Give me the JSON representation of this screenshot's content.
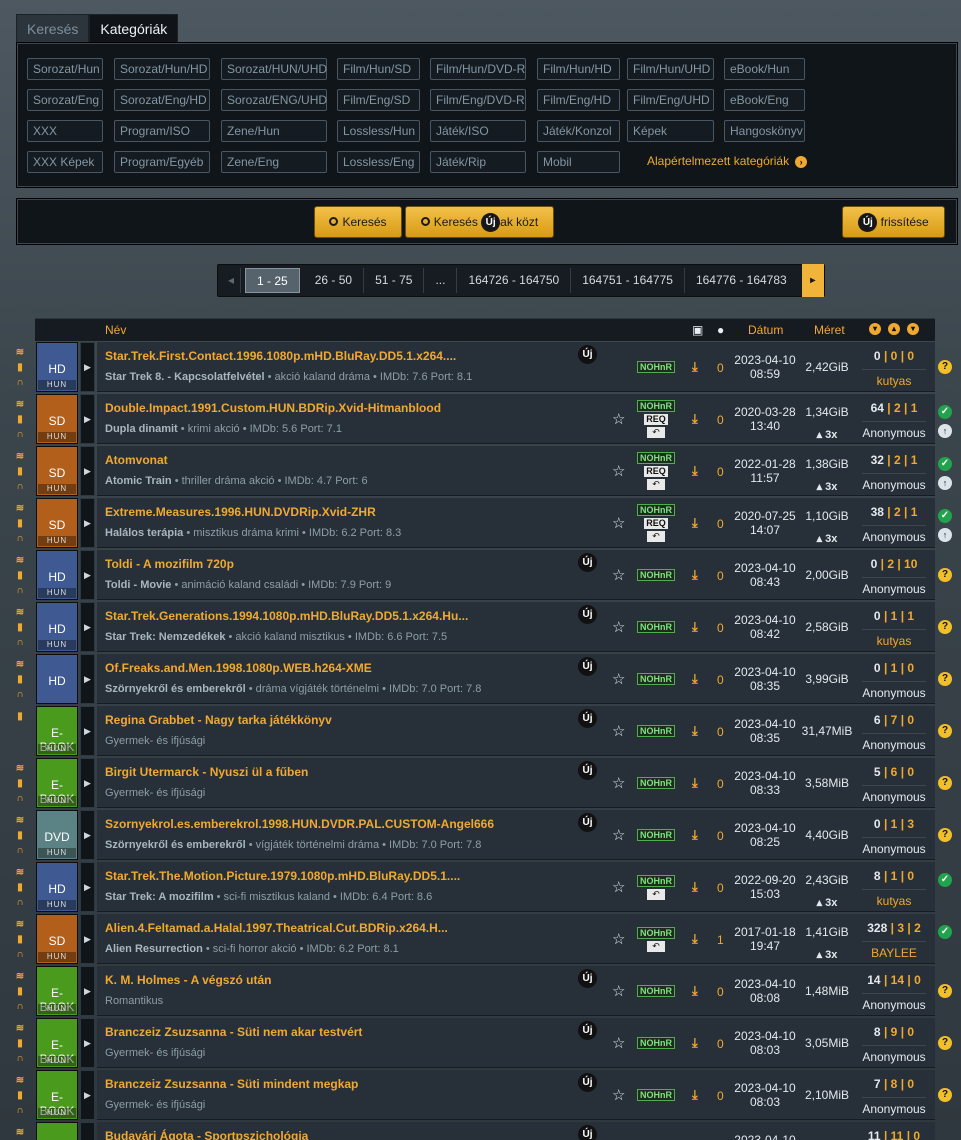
{
  "tabs": {
    "search": "Keresés",
    "categories": "Kategóriák"
  },
  "categories": {
    "rows": [
      [
        "Sorozat/Hun",
        "Sorozat/Hun/HD",
        "Sorozat/HUN/UHD",
        "Film/Hun/SD",
        "Film/Hun/DVD-R",
        "Film/Hun/HD",
        "Film/Hun/UHD",
        "eBook/Hun"
      ],
      [
        "Sorozat/Eng",
        "Sorozat/Eng/HD",
        "Sorozat/ENG/UHD",
        "Film/Eng/SD",
        "Film/Eng/DVD-R",
        "Film/Eng/HD",
        "Film/Eng/UHD",
        "eBook/Eng"
      ],
      [
        "XXX",
        "Program/ISO",
        "Zene/Hun",
        "Lossless/Hun",
        "Játék/ISO",
        "Játék/Konzol",
        "Képek",
        "Hangoskönyv"
      ],
      [
        "XXX Képek",
        "Program/Egyéb",
        "Zene/Eng",
        "Lossless/Eng",
        "Játék/Rip",
        "Mobil"
      ]
    ],
    "default_link": "Alapértelmezett kategóriák"
  },
  "search": {
    "search_button": "Keresés",
    "search_new_prefix": "Keresés",
    "search_new_suffix": "ak közt",
    "new_badge": "Új",
    "refresh_suffix": "frissítése"
  },
  "pagination": {
    "pages": [
      "1 - 25",
      "26 - 50",
      "51 - 75",
      "...",
      "164726 - 164750",
      "164751 - 164775",
      "164776 - 164783"
    ]
  },
  "table_header": {
    "name": "Név",
    "date": "Dátum",
    "size": "Méret"
  },
  "torrents": [
    {
      "cat": "HD",
      "catbg": "#3f5a92",
      "name": "Star.Trek.First.Contact.1996.1080p.mHD.BluRay.DD5.1.x264....",
      "title": "Star Trek 8. - Kapcsolatfelvétel",
      "meta": "• akció  kaland  dráma • IMDb: 7.6  Port: 8.1",
      "new": true,
      "star": false,
      "req": false,
      "undo": false,
      "comments": "0",
      "date": "2023-04-10",
      "time": "08:59",
      "size": "2,42GiB",
      "mult": "",
      "seed": "0",
      "leech": "0",
      "done": "0",
      "uploader": "kutyas",
      "gold": true,
      "status": "q",
      "rss": true
    },
    {
      "cat": "SD",
      "catbg": "#b15f1a",
      "name": "Double.Impact.1991.Custom.HUN.BDRip.Xvid-Hitmanblood",
      "title": "Dupla dinamit",
      "meta": "• krimi  akció • IMDb: 5.6  Port: 7.1",
      "new": false,
      "star": true,
      "req": true,
      "undo": true,
      "comments": "0",
      "date": "2020-03-28",
      "time": "13:40",
      "size": "1,34GiB",
      "mult": "3x",
      "seed": "64",
      "leech": "2",
      "done": "1",
      "uploader": "Anonymous",
      "gold": false,
      "status": "ok",
      "rss": true
    },
    {
      "cat": "SD",
      "catbg": "#b15f1a",
      "name": "Atomvonat",
      "title": "Atomic Train",
      "meta": "• thriller  dráma  akció • IMDb: 4.7  Port: 6",
      "new": false,
      "star": true,
      "req": true,
      "undo": true,
      "comments": "0",
      "date": "2022-01-28",
      "time": "11:57",
      "size": "1,38GiB",
      "mult": "3x",
      "seed": "32",
      "leech": "2",
      "done": "1",
      "uploader": "Anonymous",
      "gold": false,
      "status": "ok",
      "rss": true
    },
    {
      "cat": "SD",
      "catbg": "#b15f1a",
      "name": "Extreme.Measures.1996.HUN.DVDRip.Xvid-ZHR",
      "title": "Halálos terápia",
      "meta": "• misztikus  dráma  krimi • IMDb: 6.2  Port: 8.3",
      "new": false,
      "star": true,
      "req": true,
      "undo": true,
      "comments": "0",
      "date": "2020-07-25",
      "time": "14:07",
      "size": "1,10GiB",
      "mult": "3x",
      "seed": "38",
      "leech": "2",
      "done": "1",
      "uploader": "Anonymous",
      "gold": false,
      "status": "ok",
      "rss": true
    },
    {
      "cat": "HD",
      "catbg": "#3f5a92",
      "name": "Toldi - A mozifilm 720p",
      "title": "Toldi - Movie",
      "meta": "• animáció  kaland  családi • IMDb: 7.9  Port: 9",
      "new": true,
      "star": true,
      "req": false,
      "undo": false,
      "comments": "0",
      "date": "2023-04-10",
      "time": "08:43",
      "size": "2,00GiB",
      "mult": "",
      "seed": "0",
      "leech": "2",
      "done": "10",
      "uploader": "Anonymous",
      "gold": false,
      "status": "q",
      "rss": true
    },
    {
      "cat": "HD",
      "catbg": "#3f5a92",
      "name": "Star.Trek.Generations.1994.1080p.mHD.BluRay.DD5.1.x264.Hu...",
      "title": "Star Trek: Nemzedékek",
      "meta": "• akció  kaland  misztikus • IMDb: 6.6  Port: 7.5",
      "new": true,
      "star": true,
      "req": false,
      "undo": false,
      "comments": "0",
      "date": "2023-04-10",
      "time": "08:42",
      "size": "2,58GiB",
      "mult": "",
      "seed": "0",
      "leech": "1",
      "done": "1",
      "uploader": "kutyas",
      "gold": true,
      "status": "q",
      "rss": true
    },
    {
      "cat": "HD",
      "catbg": "#3f5a92",
      "name": "Of.Freaks.and.Men.1998.1080p.WEB.h264-XME",
      "title": "Szörnyekről és emberekről",
      "meta": "• dráma  vígjáték  történelmi • IMDb: 7.0  Port: 7.8",
      "new": true,
      "star": true,
      "req": false,
      "undo": false,
      "comments": "0",
      "date": "2023-04-10",
      "time": "08:35",
      "size": "3,99GiB",
      "mult": "",
      "seed": "0",
      "leech": "1",
      "done": "0",
      "uploader": "Anonymous",
      "gold": false,
      "status": "q",
      "rss": true
    },
    {
      "cat": "E-BOOK",
      "catbg": "#4a9a1e",
      "name": "Regina Grabbet - Nagy tarka játékkönyv",
      "title": "",
      "meta": "Gyermek- és ifjúsági",
      "new": true,
      "star": true,
      "req": false,
      "undo": false,
      "comments": "0",
      "date": "2023-04-10",
      "time": "08:35",
      "size": "31,47MiB",
      "mult": "",
      "seed": "6",
      "leech": "7",
      "done": "0",
      "uploader": "Anonymous",
      "gold": false,
      "status": "q",
      "rss": false
    },
    {
      "cat": "E-BOOK",
      "catbg": "#4a9a1e",
      "name": "Birgit Utermarck - Nyuszi ül a fűben",
      "title": "",
      "meta": "Gyermek- és ifjúsági",
      "new": true,
      "star": true,
      "req": false,
      "undo": false,
      "comments": "0",
      "date": "2023-04-10",
      "time": "08:33",
      "size": "3,58MiB",
      "mult": "",
      "seed": "5",
      "leech": "6",
      "done": "0",
      "uploader": "Anonymous",
      "gold": false,
      "status": "q",
      "rss": true
    },
    {
      "cat": "DVD",
      "catbg": "#5b8385",
      "name": "Szornyekrol.es.emberekrol.1998.HUN.DVDR.PAL.CUSTOM-Angel666",
      "title": "Szörnyekről és emberekről",
      "meta": "• vígjáték  történelmi  dráma • IMDb: 7.0  Port: 7.8",
      "new": true,
      "star": true,
      "req": false,
      "undo": false,
      "comments": "0",
      "date": "2023-04-10",
      "time": "08:25",
      "size": "4,40GiB",
      "mult": "",
      "seed": "0",
      "leech": "1",
      "done": "3",
      "uploader": "Anonymous",
      "gold": false,
      "status": "q",
      "rss": true
    },
    {
      "cat": "HD",
      "catbg": "#3f5a92",
      "name": "Star.Trek.The.Motion.Picture.1979.1080p.mHD.BluRay.DD5.1....",
      "title": "Star Trek: A mozifilm",
      "meta": "• sci-fi  misztikus  kaland • IMDb: 6.4  Port: 8.6",
      "new": false,
      "star": true,
      "req": false,
      "undo": true,
      "comments": "0",
      "date": "2022-09-20",
      "time": "15:03",
      "size": "2,43GiB",
      "mult": "3x",
      "seed": "8",
      "leech": "1",
      "done": "0",
      "uploader": "kutyas",
      "gold": true,
      "status": "ok",
      "rss": true
    },
    {
      "cat": "SD",
      "catbg": "#b15f1a",
      "name": "Alien.4.Feltamad.a.Halal.1997.Theatrical.Cut.BDRip.x264.H...",
      "title": "Alien Resurrection",
      "meta": "• sci-fi  horror  akció • IMDb: 6.2  Port: 8.1",
      "new": false,
      "star": true,
      "req": false,
      "undo": true,
      "comments": "1",
      "date": "2017-01-18",
      "time": "19:47",
      "size": "1,41GiB",
      "mult": "3x",
      "seed": "328",
      "leech": "3",
      "done": "2",
      "uploader": "BAYLEE",
      "gold": true,
      "status": "ok",
      "rss": true
    },
    {
      "cat": "E-BOOK",
      "catbg": "#4a9a1e",
      "name": "K. M. Holmes - A végszó után",
      "title": "",
      "meta": "Romantikus",
      "new": true,
      "star": true,
      "req": false,
      "undo": false,
      "comments": "0",
      "date": "2023-04-10",
      "time": "08:08",
      "size": "1,48MiB",
      "mult": "",
      "seed": "14",
      "leech": "14",
      "done": "0",
      "uploader": "Anonymous",
      "gold": false,
      "status": "q",
      "rss": true
    },
    {
      "cat": "E-BOOK",
      "catbg": "#4a9a1e",
      "name": "Branczeiz Zsuzsanna - Süti nem akar testvért",
      "title": "",
      "meta": "Gyermek- és ifjúsági",
      "new": true,
      "star": true,
      "req": false,
      "undo": false,
      "comments": "0",
      "date": "2023-04-10",
      "time": "08:03",
      "size": "3,05MiB",
      "mult": "",
      "seed": "8",
      "leech": "9",
      "done": "0",
      "uploader": "Anonymous",
      "gold": false,
      "status": "q",
      "rss": true
    },
    {
      "cat": "E-BOOK",
      "catbg": "#4a9a1e",
      "name": "Branczeiz Zsuzsanna - Süti mindent megkap",
      "title": "",
      "meta": "Gyermek- és ifjúsági",
      "new": true,
      "star": true,
      "req": false,
      "undo": false,
      "comments": "0",
      "date": "2023-04-10",
      "time": "08:03",
      "size": "2,10MiB",
      "mult": "",
      "seed": "7",
      "leech": "8",
      "done": "0",
      "uploader": "Anonymous",
      "gold": false,
      "status": "q",
      "rss": true
    },
    {
      "cat": "E-BOOK",
      "catbg": "#4a9a1e",
      "name": "Budavári Ágota - Sportpszichológia",
      "title": "",
      "meta": "",
      "new": true,
      "star": true,
      "req": false,
      "undo": false,
      "comments": "0",
      "date": "2023-04-10",
      "time": "",
      "size": "",
      "mult": "",
      "seed": "11",
      "leech": "11",
      "done": "0",
      "uploader": "",
      "gold": false,
      "status": "q",
      "rss": true
    }
  ],
  "labels": {
    "nohnr": "NOHnR",
    "req": "REQ",
    "hun": "HUN"
  }
}
